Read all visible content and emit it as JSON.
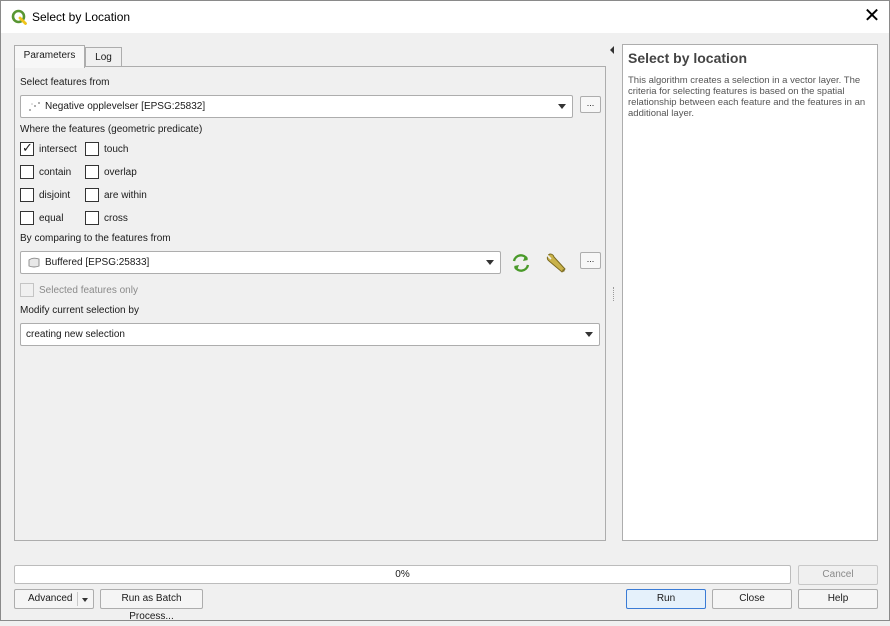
{
  "window": {
    "title": "Select by Location"
  },
  "tabs": [
    {
      "label": "Parameters",
      "active": true
    },
    {
      "label": "Log",
      "active": false
    }
  ],
  "params": {
    "select_from_label": "Select features from",
    "select_from_value": "Negative opplevelser [EPSG:25832]",
    "predicate_label": "Where the features (geometric predicate)",
    "predicates": [
      {
        "label": "intersect",
        "checked": true
      },
      {
        "label": "touch",
        "checked": false
      },
      {
        "label": "contain",
        "checked": false
      },
      {
        "label": "overlap",
        "checked": false
      },
      {
        "label": "disjoint",
        "checked": false
      },
      {
        "label": "are within",
        "checked": false
      },
      {
        "label": "equal",
        "checked": false
      },
      {
        "label": "cross",
        "checked": false
      }
    ],
    "compare_label": "By comparing to the features from",
    "compare_value": "Buffered [EPSG:25833]",
    "selected_only_label": "Selected features only",
    "modify_label": "Modify current selection by",
    "modify_value": "creating new selection",
    "dots_label": "..."
  },
  "help": {
    "title": "Select by location",
    "body": "This algorithm creates a selection in a vector layer. The criteria for selecting features is based on the spatial relationship between each feature and the features in an additional layer."
  },
  "progress": {
    "value": 0,
    "text": "0%"
  },
  "buttons": {
    "cancel": "Cancel",
    "advanced": "Advanced",
    "batch": "Run as Batch Process...",
    "run": "Run",
    "close": "Close",
    "help": "Help"
  },
  "colors": {
    "progress_fill": "#06b025",
    "default_button_border": "#3a7bd5",
    "qgis_green": "#589632"
  }
}
